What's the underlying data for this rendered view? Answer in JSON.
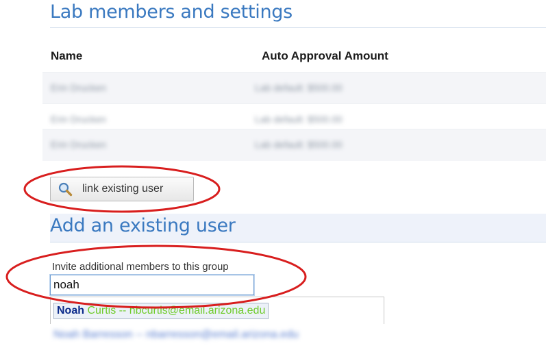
{
  "section": {
    "title": "Lab members and settings"
  },
  "table": {
    "headers": {
      "name": "Name",
      "amount": "Auto Approval Amount"
    },
    "rows": [
      {
        "name": "Erin Drucken",
        "amount": "Lab default: $500.00"
      },
      {
        "name": "Erin Drucken",
        "amount": "Lab default: $500.00"
      },
      {
        "name": "Erin Drucken",
        "amount": "Lab default: $500.00"
      }
    ]
  },
  "actions": {
    "link_user_label": "link existing user",
    "link_user_icon": "magnifier-icon"
  },
  "add_user": {
    "title": "Add an existing user",
    "invite_label": "Invite additional members to this group",
    "input_value": "noah"
  },
  "autocomplete": {
    "active": {
      "match": "Noah",
      "rest": "Curtis",
      "separator": " -- ",
      "email": "nbcurtis@email.arizona.edu"
    },
    "next": "Noah Barresson -- nbarresson@email.arizona.edu"
  },
  "colors": {
    "heading": "#3a79c0",
    "annotation": "#d81e1e",
    "match_text": "#0b2a8a",
    "suggestion_text": "#6fcb2b"
  }
}
